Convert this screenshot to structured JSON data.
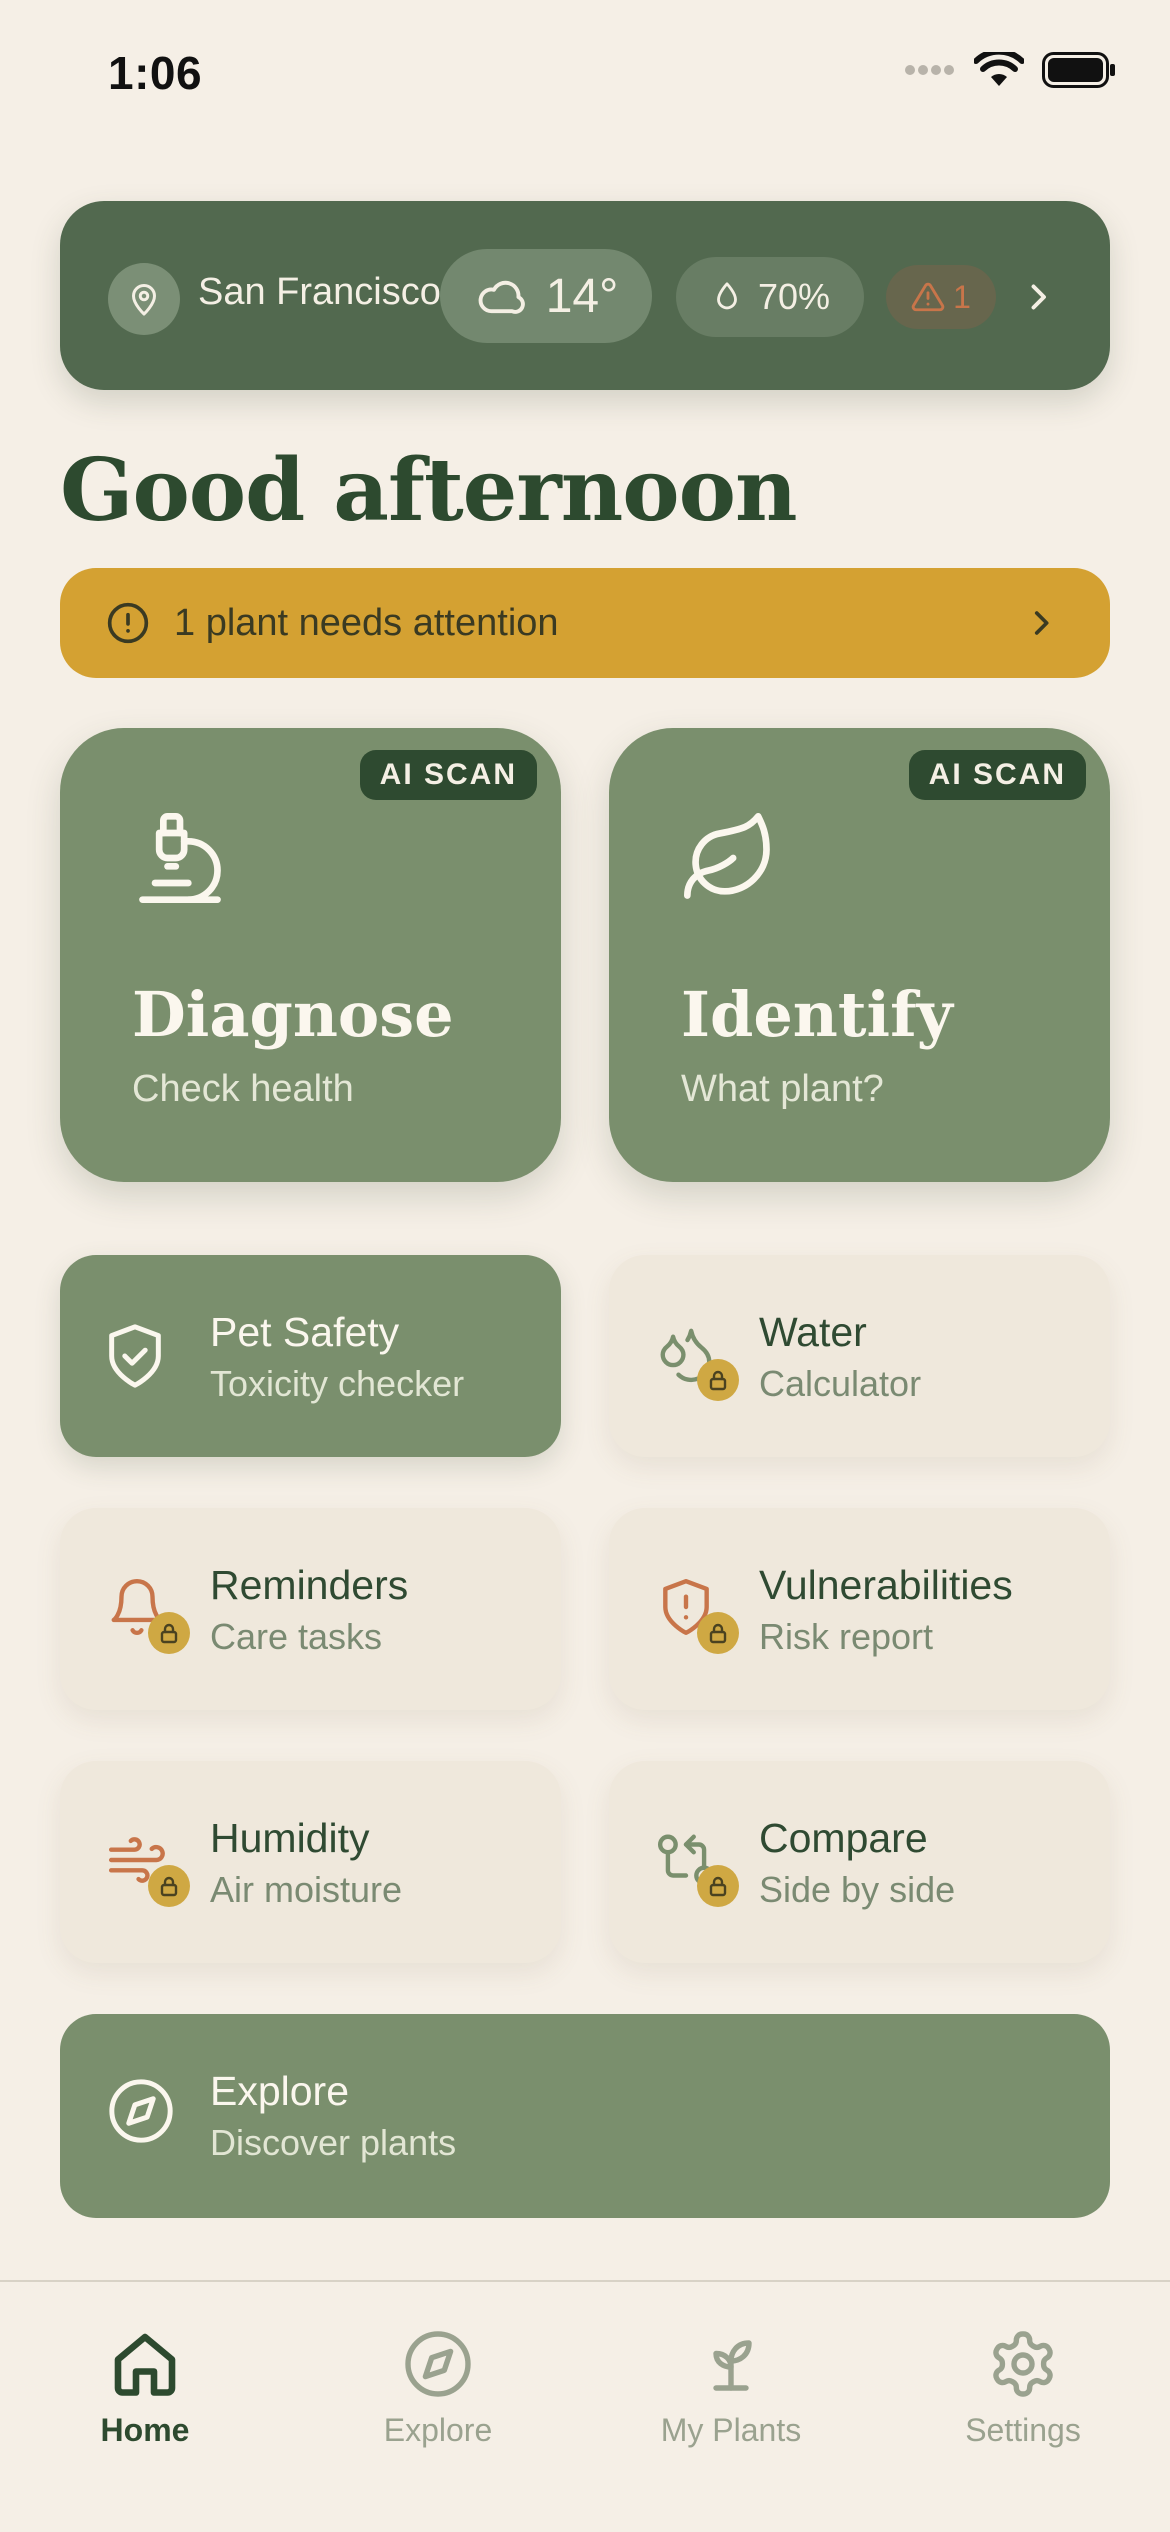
{
  "status_bar": {
    "time": "1:06"
  },
  "weather": {
    "location": "San Francisco",
    "temperature": "14°",
    "humidity": "70%",
    "alert_count": "1"
  },
  "greeting": "Good afternoon",
  "attention": {
    "text": "1 plant needs attention"
  },
  "big_cards": [
    {
      "badge": "AI SCAN",
      "title": "Diagnose",
      "subtitle": "Check health",
      "icon": "microscope-icon"
    },
    {
      "badge": "AI SCAN",
      "title": "Identify",
      "subtitle": "What plant?",
      "icon": "leaf-icon"
    }
  ],
  "tiles": [
    {
      "title": "Pet Safety",
      "subtitle": "Toxicity checker",
      "icon": "shield-check-icon",
      "locked": false
    },
    {
      "title": "Water",
      "subtitle": "Calculator",
      "icon": "droplets-icon",
      "locked": true
    },
    {
      "title": "Reminders",
      "subtitle": "Care tasks",
      "icon": "bell-icon",
      "locked": true
    },
    {
      "title": "Vulnerabilities",
      "subtitle": "Risk report",
      "icon": "shield-alert-icon",
      "locked": true
    },
    {
      "title": "Humidity",
      "subtitle": "Air moisture",
      "icon": "wind-icon",
      "locked": true
    },
    {
      "title": "Compare",
      "subtitle": "Side by side",
      "icon": "compare-icon",
      "locked": true
    }
  ],
  "explore_tile": {
    "title": "Explore",
    "subtitle": "Discover plants",
    "icon": "compass-icon"
  },
  "tabs": [
    {
      "label": "Home",
      "icon": "home-icon",
      "active": true
    },
    {
      "label": "Explore",
      "icon": "compass-icon",
      "active": false
    },
    {
      "label": "My Plants",
      "icon": "sprout-icon",
      "active": false
    },
    {
      "label": "Settings",
      "icon": "gear-icon",
      "active": false
    }
  ],
  "colors": {
    "background": "#f5efe6",
    "primary_dark": "#2d4a2f",
    "card_green": "#7a8f6d",
    "weather_green": "#52694f",
    "attention_yellow": "#d4a132",
    "lock_gold": "#cfa843",
    "warning_orange": "#c8754a"
  }
}
